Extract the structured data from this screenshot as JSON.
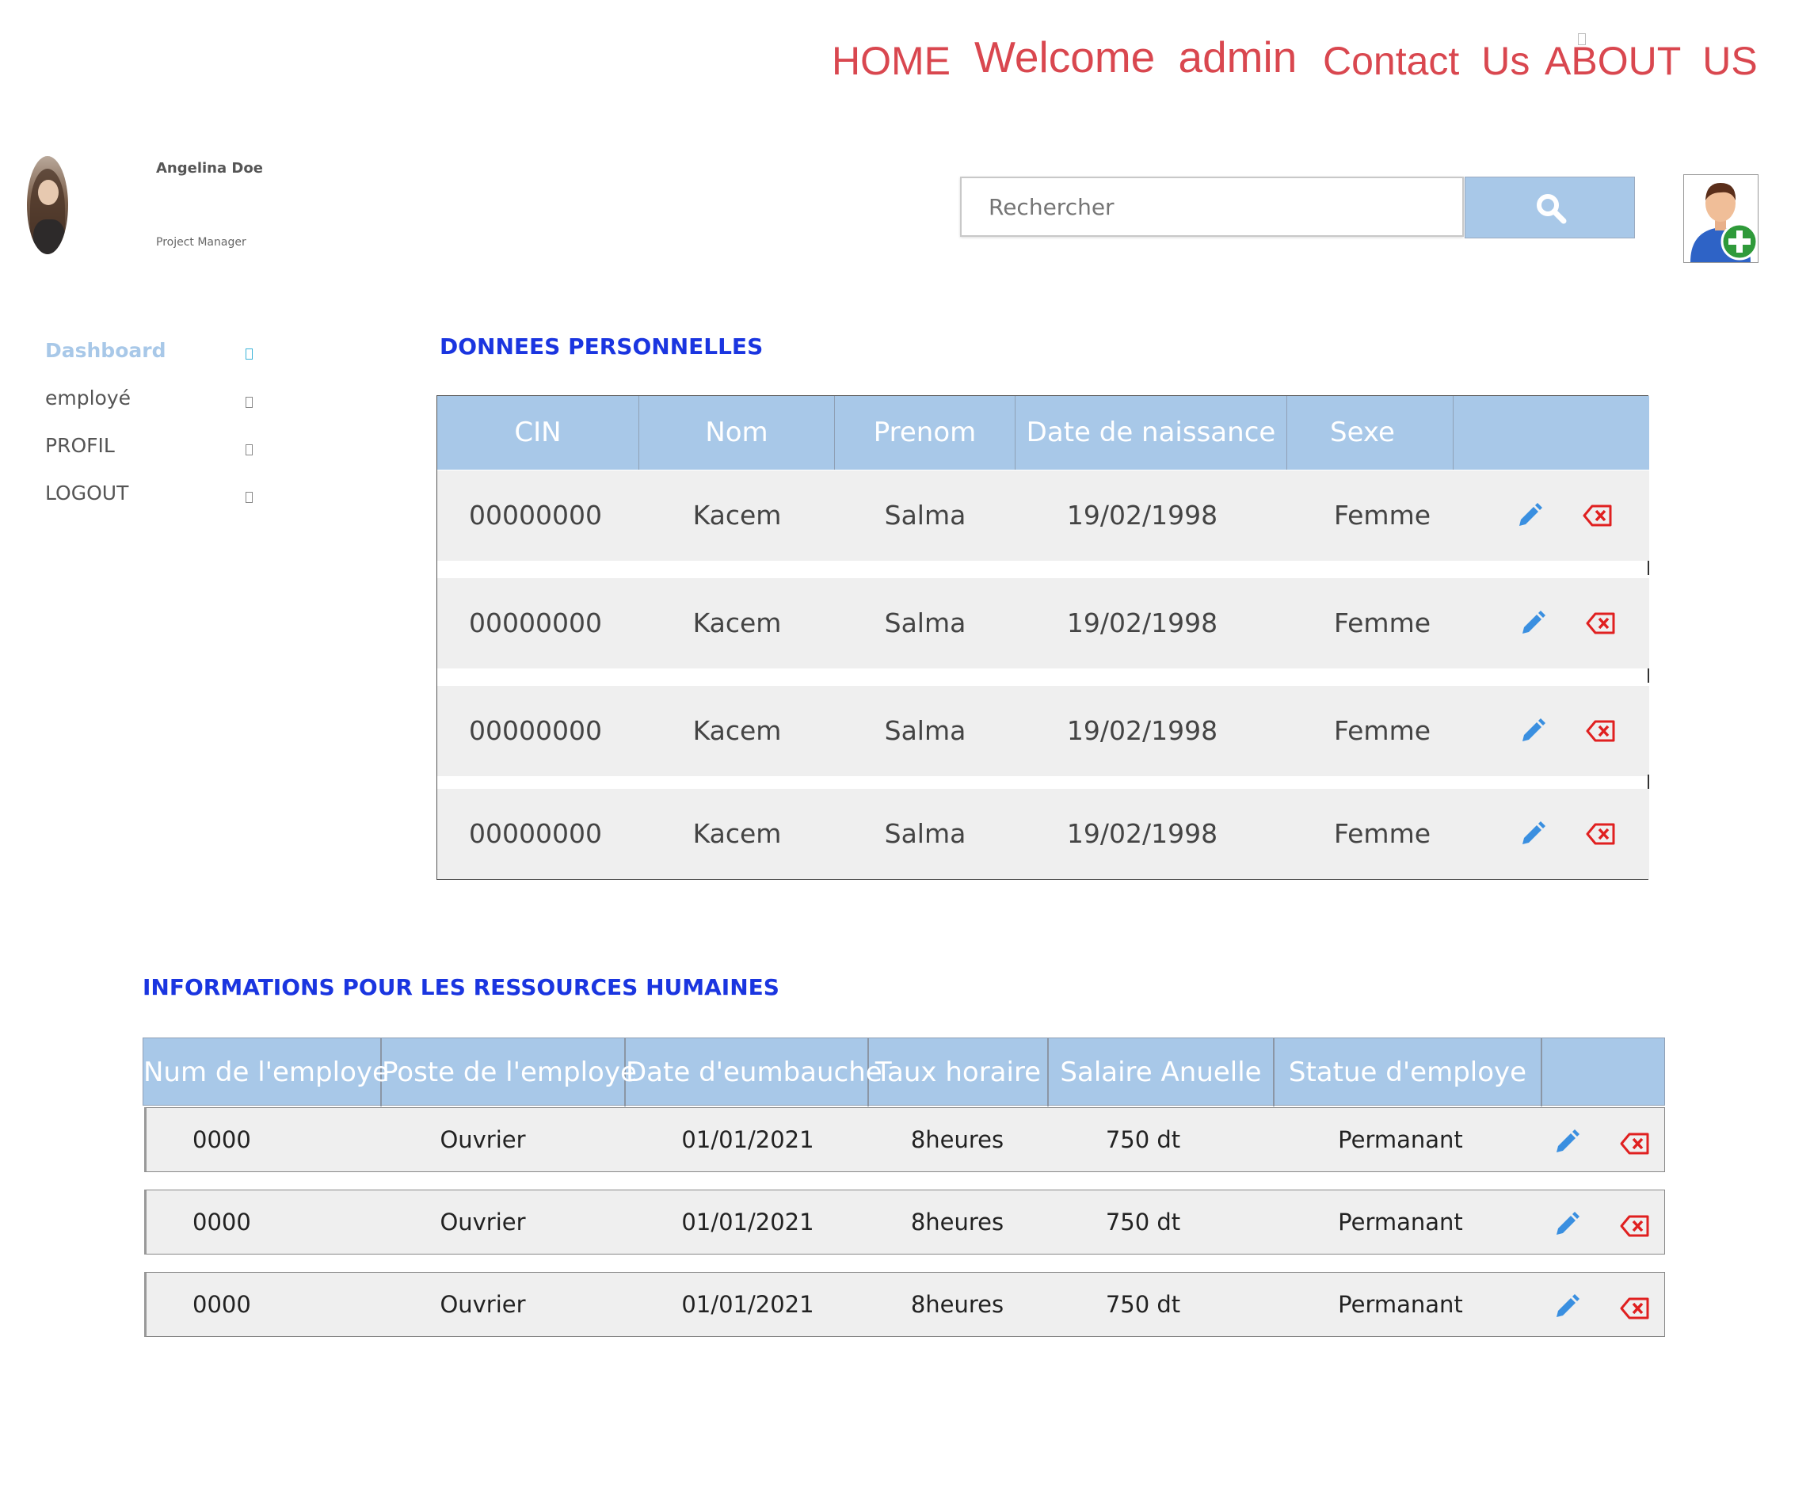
{
  "nav": {
    "home": "HOME",
    "welcome": "Welcome  admin",
    "contact": "Contact  Us",
    "about": "ABOUT  US"
  },
  "profile": {
    "name": "Angelina Doe",
    "role": "Project Manager"
  },
  "search": {
    "placeholder": "Rechercher"
  },
  "sidebar": {
    "items": [
      {
        "label": "Dashboard",
        "active": true
      },
      {
        "label": "employé",
        "active": false
      },
      {
        "label": "PROFIL",
        "active": false
      },
      {
        "label": "LOGOUT",
        "active": false
      }
    ]
  },
  "personal": {
    "title": "DONNEES PERSONNELLES",
    "headers": [
      "CIN",
      "Nom",
      "Prenom",
      "Date de naissance",
      "Sexe",
      ""
    ],
    "rows": [
      [
        "00000000",
        "Kacem",
        "Salma",
        "19/02/1998",
        "Femme"
      ],
      [
        "00000000",
        "Kacem",
        "Salma",
        "19/02/1998",
        "Femme"
      ],
      [
        "00000000",
        "Kacem",
        "Salma",
        "19/02/1998",
        "Femme"
      ],
      [
        "00000000",
        "Kacem",
        "Salma",
        "19/02/1998",
        "Femme"
      ]
    ]
  },
  "hr": {
    "title": "INFORMATIONS POUR LES RESSOURCES HUMAINES",
    "headers": [
      "Num de l'employe",
      "Poste de l'employe",
      "Date d'eumbauche",
      "Taux horaire",
      "Salaire Anuelle",
      "Statue d'employe",
      ""
    ],
    "rows": [
      [
        "0000",
        "Ouvrier",
        "01/01/2021",
        "8heures",
        "750 dt",
        "Permanant"
      ],
      [
        "0000",
        "Ouvrier",
        "01/01/2021",
        "8heures",
        "750 dt",
        "Permanant"
      ],
      [
        "0000",
        "Ouvrier",
        "01/01/2021",
        "8heures",
        "750 dt",
        "Permanant"
      ]
    ]
  },
  "colors": {
    "accent_red": "#d9474f",
    "header_blue": "#a8c8e8",
    "title_blue": "#1a35e0",
    "edit_icon": "#3a8fe0",
    "delete_icon": "#e02020"
  },
  "icons": {
    "search": "search-icon",
    "add_user": "add-user-icon",
    "edit": "pencil-icon",
    "delete": "delete-backspace-icon"
  }
}
